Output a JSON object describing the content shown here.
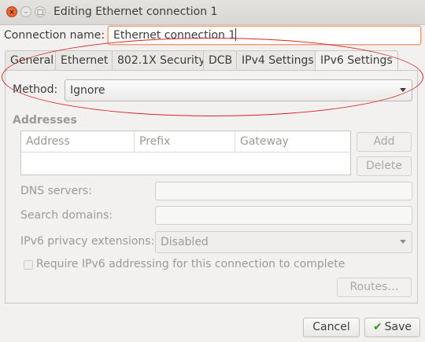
{
  "window": {
    "title": "Editing Ethernet connection 1",
    "close_glyph": "×",
    "minimize_glyph": "–",
    "maximize_glyph": "□"
  },
  "connection_name": {
    "label": "Connection name:",
    "value": "Ethernet connection 1"
  },
  "tabs": [
    {
      "label": "General"
    },
    {
      "label": "Ethernet"
    },
    {
      "label": "802.1X Security"
    },
    {
      "label": "DCB"
    },
    {
      "label": "IPv4 Settings"
    },
    {
      "label": "IPv6 Settings",
      "active": true
    }
  ],
  "method": {
    "label": "Method:",
    "value": "Ignore"
  },
  "addresses": {
    "heading": "Addresses",
    "columns": [
      "Address",
      "Prefix",
      "Gateway"
    ],
    "add_label": "Add",
    "delete_label": "Delete"
  },
  "dns_servers": {
    "label": "DNS servers:",
    "value": ""
  },
  "search_domains": {
    "label": "Search domains:",
    "value": ""
  },
  "privacy": {
    "label": "IPv6 privacy extensions:",
    "value": "Disabled"
  },
  "require": {
    "label": "Require IPv6 addressing for this connection to complete",
    "checked": false
  },
  "routes_label": "Routes…",
  "footer": {
    "cancel_label": "Cancel",
    "save_label": "Save",
    "save_icon": "check-icon"
  },
  "colors": {
    "annotation_ring": "#d8242a",
    "close_button": "#e4531f"
  }
}
